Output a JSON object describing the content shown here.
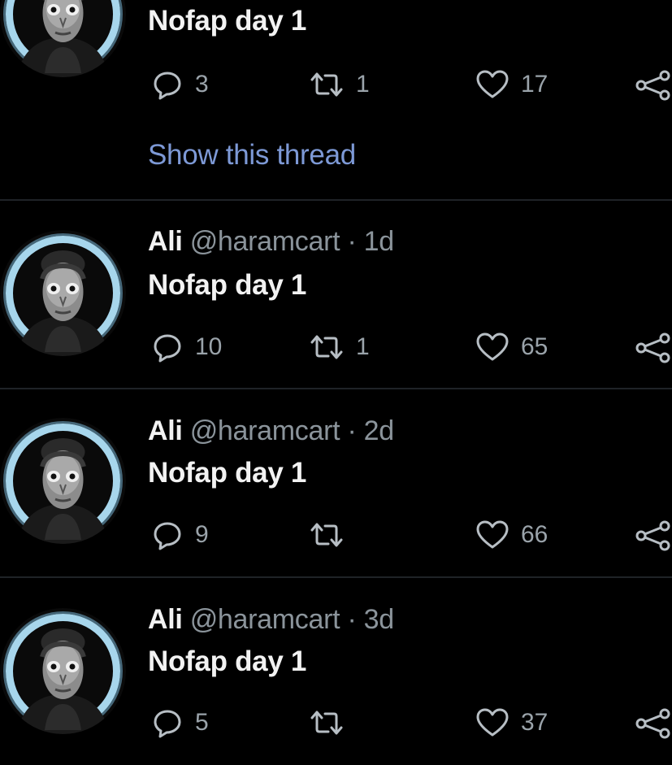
{
  "colors": {
    "background": "#000000",
    "divider": "#1f2327",
    "link": "#7d99d6",
    "muted": "#8b949b",
    "text": "#f2f2f2",
    "avatar_ring": "#9fd2ea"
  },
  "tweets": [
    {
      "text": "Nofap day 1",
      "reply_count": "3",
      "retweet_count": "1",
      "like_count": "17",
      "show_thread": "Show this thread"
    },
    {
      "name": "Ali",
      "handle": "@haramcart",
      "time": "· 1d",
      "text": "Nofap day 1",
      "reply_count": "10",
      "retweet_count": "1",
      "like_count": "65"
    },
    {
      "name": "Ali",
      "handle": "@haramcart",
      "time": "· 2d",
      "text": "Nofap day 1",
      "reply_count": "9",
      "retweet_count": "",
      "like_count": "66"
    },
    {
      "name": "Ali",
      "handle": "@haramcart",
      "time": "· 3d",
      "text": "Nofap day 1",
      "reply_count": "5",
      "retweet_count": "",
      "like_count": "37"
    }
  ],
  "icons": {
    "reply": "reply-icon",
    "retweet": "retweet-icon",
    "like": "heart-icon",
    "share": "share-icon"
  }
}
